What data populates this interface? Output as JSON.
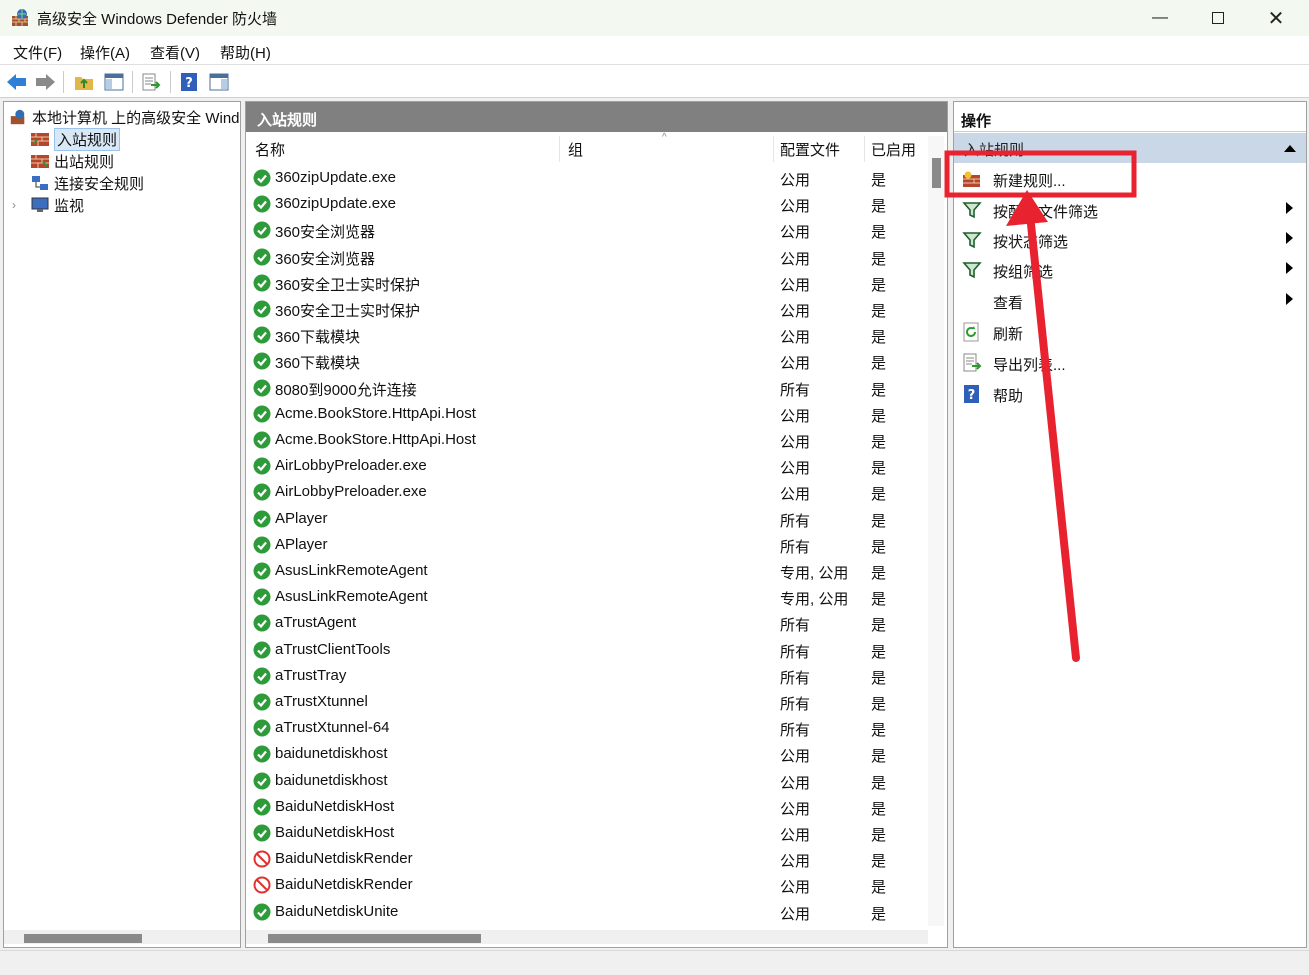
{
  "window": {
    "title": "高级安全 Windows Defender 防火墙"
  },
  "menu": [
    "文件(F)",
    "操作(A)",
    "查看(V)",
    "帮助(H)"
  ],
  "tree": {
    "root": "本地计算机 上的高级安全 Windows Defender 防火墙",
    "items": [
      "入站规则",
      "出站规则",
      "连接安全规则",
      "监视"
    ]
  },
  "center": {
    "header": "入站规则",
    "columns": {
      "name": "名称",
      "group": "组",
      "profile": "配置文件",
      "enabled": "已启用"
    },
    "rows": [
      {
        "name": "360zipUpdate.exe",
        "profile": "公用",
        "enabled": "是",
        "status": "allow"
      },
      {
        "name": "360zipUpdate.exe",
        "profile": "公用",
        "enabled": "是",
        "status": "allow"
      },
      {
        "name": "360安全浏览器",
        "profile": "公用",
        "enabled": "是",
        "status": "allow"
      },
      {
        "name": "360安全浏览器",
        "profile": "公用",
        "enabled": "是",
        "status": "allow"
      },
      {
        "name": "360安全卫士实时保护",
        "profile": "公用",
        "enabled": "是",
        "status": "allow"
      },
      {
        "name": "360安全卫士实时保护",
        "profile": "公用",
        "enabled": "是",
        "status": "allow"
      },
      {
        "name": "360下载模块",
        "profile": "公用",
        "enabled": "是",
        "status": "allow"
      },
      {
        "name": "360下载模块",
        "profile": "公用",
        "enabled": "是",
        "status": "allow"
      },
      {
        "name": "8080到9000允许连接",
        "profile": "所有",
        "enabled": "是",
        "status": "allow"
      },
      {
        "name": "Acme.BookStore.HttpApi.Host",
        "profile": "公用",
        "enabled": "是",
        "status": "allow"
      },
      {
        "name": "Acme.BookStore.HttpApi.Host",
        "profile": "公用",
        "enabled": "是",
        "status": "allow"
      },
      {
        "name": "AirLobbyPreloader.exe",
        "profile": "公用",
        "enabled": "是",
        "status": "allow"
      },
      {
        "name": "AirLobbyPreloader.exe",
        "profile": "公用",
        "enabled": "是",
        "status": "allow"
      },
      {
        "name": "APlayer",
        "profile": "所有",
        "enabled": "是",
        "status": "allow"
      },
      {
        "name": "APlayer",
        "profile": "所有",
        "enabled": "是",
        "status": "allow"
      },
      {
        "name": "AsusLinkRemoteAgent",
        "profile": "专用, 公用",
        "enabled": "是",
        "status": "allow"
      },
      {
        "name": "AsusLinkRemoteAgent",
        "profile": "专用, 公用",
        "enabled": "是",
        "status": "allow"
      },
      {
        "name": "aTrustAgent",
        "profile": "所有",
        "enabled": "是",
        "status": "allow"
      },
      {
        "name": "aTrustClientTools",
        "profile": "所有",
        "enabled": "是",
        "status": "allow"
      },
      {
        "name": "aTrustTray",
        "profile": "所有",
        "enabled": "是",
        "status": "allow"
      },
      {
        "name": "aTrustXtunnel",
        "profile": "所有",
        "enabled": "是",
        "status": "allow"
      },
      {
        "name": "aTrustXtunnel-64",
        "profile": "所有",
        "enabled": "是",
        "status": "allow"
      },
      {
        "name": "baidunetdiskhost",
        "profile": "公用",
        "enabled": "是",
        "status": "allow"
      },
      {
        "name": "baidunetdiskhost",
        "profile": "公用",
        "enabled": "是",
        "status": "allow"
      },
      {
        "name": "BaiduNetdiskHost",
        "profile": "公用",
        "enabled": "是",
        "status": "allow"
      },
      {
        "name": "BaiduNetdiskHost",
        "profile": "公用",
        "enabled": "是",
        "status": "allow"
      },
      {
        "name": "BaiduNetdiskRender",
        "profile": "公用",
        "enabled": "是",
        "status": "block"
      },
      {
        "name": "BaiduNetdiskRender",
        "profile": "公用",
        "enabled": "是",
        "status": "block"
      },
      {
        "name": "BaiduNetdiskUnite",
        "profile": "公用",
        "enabled": "是",
        "status": "allow"
      }
    ]
  },
  "actions": {
    "header": "操作",
    "section": "入站规则",
    "items": [
      {
        "label": "新建规则...",
        "icon": "new-rule-icon",
        "submenu": false
      },
      {
        "label": "按配置文件筛选",
        "icon": "filter-icon",
        "submenu": true
      },
      {
        "label": "按状态筛选",
        "icon": "filter-icon",
        "submenu": true
      },
      {
        "label": "按组筛选",
        "icon": "filter-icon",
        "submenu": true
      },
      {
        "label": "查看",
        "icon": "",
        "submenu": true
      },
      {
        "label": "刷新",
        "icon": "refresh-icon",
        "submenu": false
      },
      {
        "label": "导出列表...",
        "icon": "export-icon",
        "submenu": false
      },
      {
        "label": "帮助",
        "icon": "help-icon",
        "submenu": false
      }
    ]
  },
  "colors": {
    "annotation": "#e8232f",
    "allow": "#2e9b3a",
    "block": "#e0312d",
    "header_gray": "#808080",
    "section_blue": "#c9d7e6"
  }
}
